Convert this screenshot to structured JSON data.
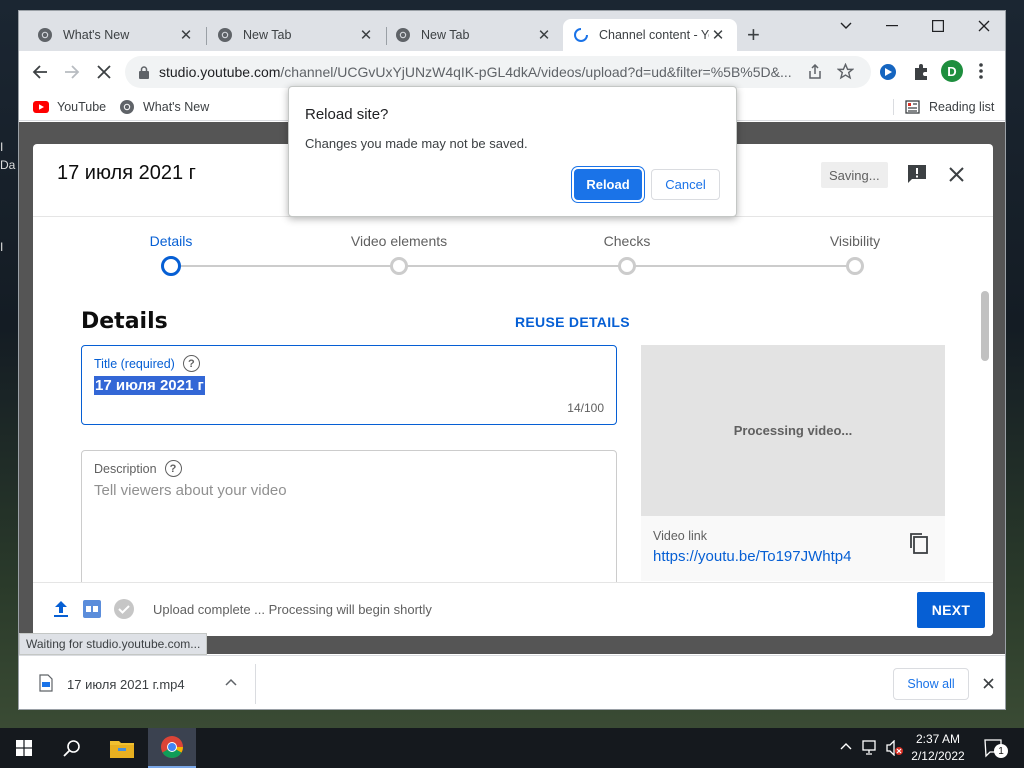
{
  "browser": {
    "tabs": [
      {
        "title": "What's New",
        "state": "normal"
      },
      {
        "title": "New Tab",
        "state": "normal"
      },
      {
        "title": "New Tab",
        "state": "normal"
      },
      {
        "title": "Channel content - Yo",
        "state": "active-loading"
      }
    ],
    "new_tab_glyph": "+",
    "url_host": "studio.youtube.com",
    "url_path": "/channel/UCGvUxYjUNzW4qIK-pGL4dkA/videos/upload?d=ud&filter=%5B%5D&...",
    "profile_initial": "D",
    "bookmarks": [
      {
        "label": "YouTube",
        "icon": "youtube-icon"
      },
      {
        "label": "What's New",
        "icon": "chrome-icon"
      }
    ],
    "reading_list": "Reading list",
    "status_text": "Waiting for studio.youtube.com...",
    "download": {
      "filename": "17 июля 2021 г.mp4",
      "show_all": "Show all"
    }
  },
  "popup": {
    "title": "Reload site?",
    "message": "Changes you made may not be saved.",
    "reload_label": "Reload",
    "cancel_label": "Cancel"
  },
  "upload": {
    "title": "17 июля 2021 г",
    "saving": "Saving...",
    "steps": [
      "Details",
      "Video elements",
      "Checks",
      "Visibility"
    ],
    "active_step": 0,
    "section_title": "Details",
    "reuse_label": "REUSE DETAILS",
    "title_field": {
      "label": "Title (required)",
      "value": "17 июля 2021 г",
      "count": "14/100"
    },
    "description_field": {
      "label": "Description",
      "placeholder": "Tell viewers about your video"
    },
    "preview": {
      "processing": "Processing video...",
      "link_label": "Video link",
      "link": "https://youtu.be/To197JWhtp4"
    },
    "footer_status": "Upload complete ... Processing will begin shortly",
    "next_label": "NEXT"
  },
  "taskbar": {
    "time": "2:37 AM",
    "date": "2/12/2022",
    "notification_count": "1"
  },
  "colors": {
    "accent": "#065fd4",
    "chrome_blue": "#1a73e8",
    "youtube_red": "#ff0000"
  }
}
